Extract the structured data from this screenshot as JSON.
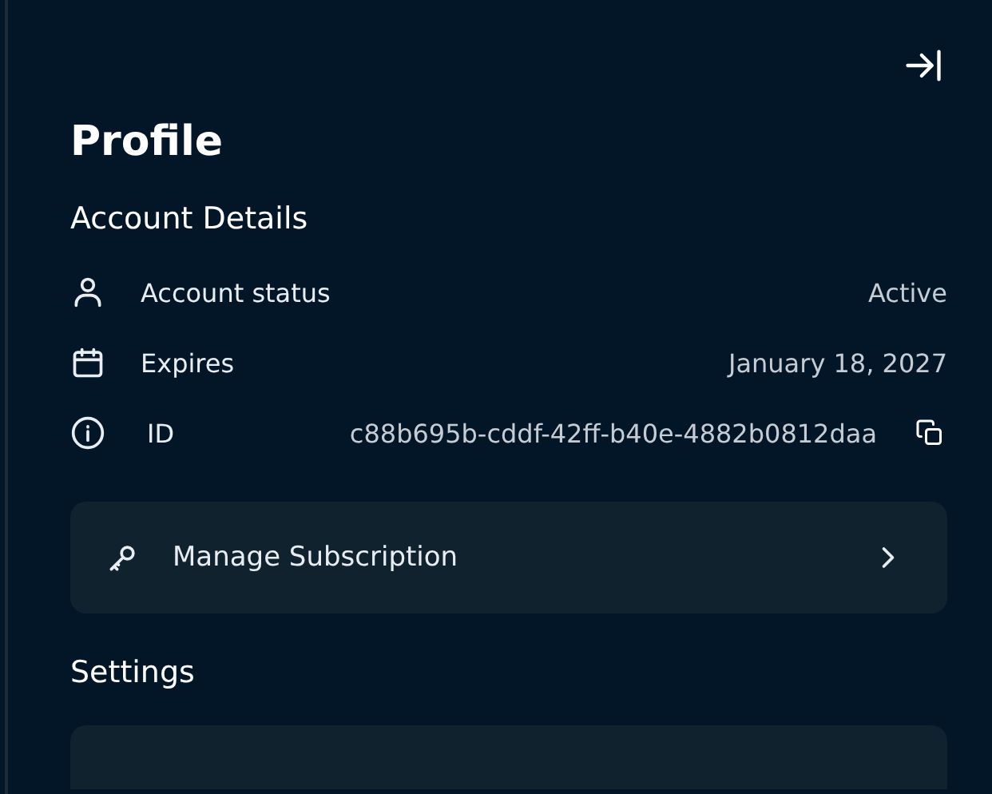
{
  "title": "Profile",
  "account_details": {
    "heading": "Account Details",
    "rows": [
      {
        "kind": "status",
        "label": "Account status",
        "value": "Active"
      },
      {
        "kind": "date",
        "label": "Expires",
        "value": "January 18, 2027"
      },
      {
        "kind": "id",
        "label": "ID",
        "value": "c88b695b-cddf-42ff-b40e-4882b0812daa"
      }
    ]
  },
  "manage_subscription": {
    "label": "Manage Subscription"
  },
  "settings": {
    "heading": "Settings"
  }
}
